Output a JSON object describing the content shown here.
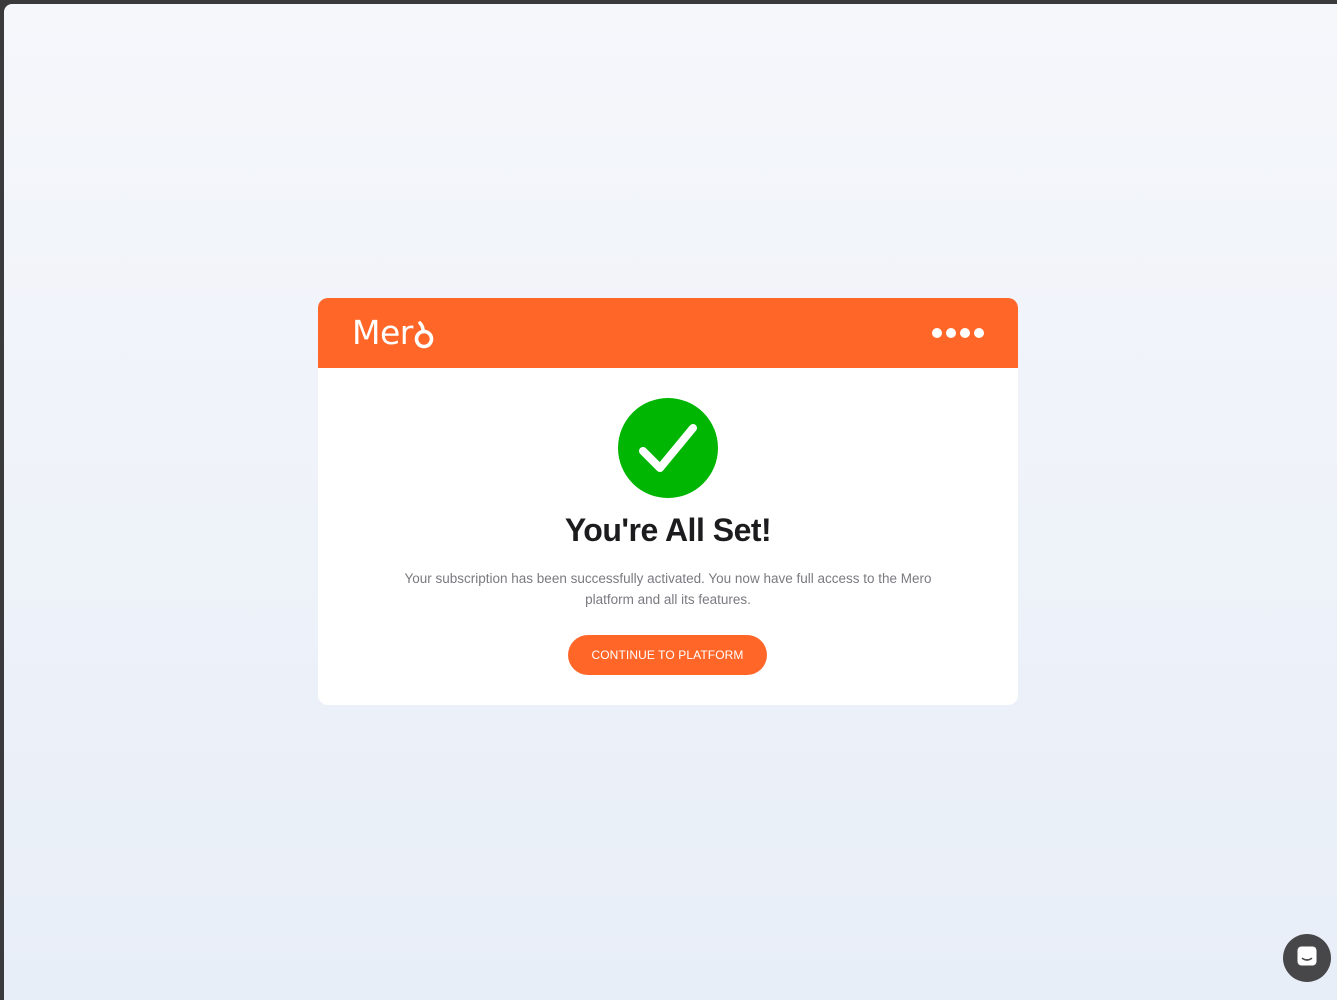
{
  "brand": {
    "name_prefix": "Mer",
    "accent_color": "#ff6628",
    "success_color": "#00b603"
  },
  "header": {
    "menu_icon": "more-dots-icon"
  },
  "confirmation": {
    "icon": "checkmark-icon",
    "title": "You're All Set!",
    "description": "Your subscription has been successfully activated. You now have full access to the Mero platform and all its features.",
    "cta_label": "CONTINUE TO PLATFORM"
  },
  "support": {
    "icon": "chat-icon"
  }
}
